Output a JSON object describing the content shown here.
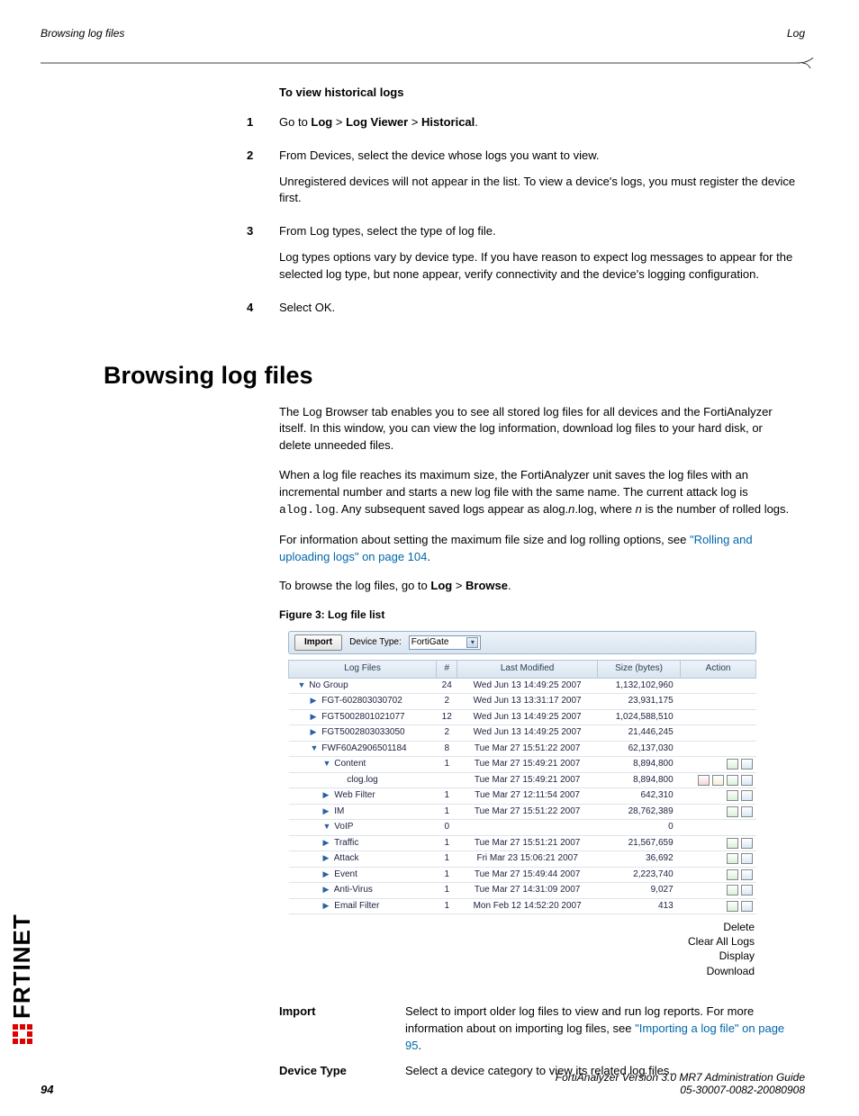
{
  "header": {
    "left": "Browsing log files",
    "right": "Log"
  },
  "proc": {
    "title": "To view historical logs",
    "steps": [
      {
        "num": "1",
        "paras": [
          {
            "segments": [
              {
                "t": "Go to "
              },
              {
                "t": "Log",
                "b": true
              },
              {
                "t": " > "
              },
              {
                "t": "Log Viewer",
                "b": true
              },
              {
                "t": " > "
              },
              {
                "t": "Historical",
                "b": true
              },
              {
                "t": "."
              }
            ]
          }
        ]
      },
      {
        "num": "2",
        "paras": [
          {
            "segments": [
              {
                "t": "From Devices, select the device whose logs you want to view."
              }
            ]
          },
          {
            "segments": [
              {
                "t": "Unregistered devices will not appear in the list. To view a device's logs, you must register the device first."
              }
            ]
          }
        ]
      },
      {
        "num": "3",
        "paras": [
          {
            "segments": [
              {
                "t": "From Log types, select the type of log file."
              }
            ]
          },
          {
            "segments": [
              {
                "t": "Log types options vary by device type. If you have reason to expect log messages to appear for the selected log type, but none appear, verify connectivity and the device's logging configuration."
              }
            ]
          }
        ]
      },
      {
        "num": "4",
        "paras": [
          {
            "segments": [
              {
                "t": "Select OK."
              }
            ]
          }
        ]
      }
    ]
  },
  "section": {
    "title": "Browsing log files",
    "paras": [
      {
        "segments": [
          {
            "t": "The Log Browser tab enables you to see all stored log files for all devices and the FortiAnalyzer itself. In this window, you can view the log information, download log files to your hard disk, or delete unneeded files."
          }
        ]
      },
      {
        "segments": [
          {
            "t": "When a log file reaches its maximum size, the FortiAnalyzer unit saves the log files with an incremental number and starts a new log file with the same name. The current attack log is "
          },
          {
            "t": "alog.log",
            "mono": true
          },
          {
            "t": ". Any subsequent saved logs appear as alog."
          },
          {
            "t": "n",
            "i": true
          },
          {
            "t": ".log, where "
          },
          {
            "t": "n",
            "i": true
          },
          {
            "t": " is the number of rolled logs."
          }
        ]
      },
      {
        "segments": [
          {
            "t": "For information about setting the maximum file size and log rolling options, see "
          },
          {
            "t": "\"Rolling and uploading logs\" on page 104",
            "link": true
          },
          {
            "t": "."
          }
        ]
      },
      {
        "segments": [
          {
            "t": "To browse the log files, go to "
          },
          {
            "t": "Log",
            "b": true
          },
          {
            "t": " > "
          },
          {
            "t": "Browse",
            "b": true
          },
          {
            "t": "."
          }
        ]
      }
    ],
    "fig_caption": "Figure 3:   Log file list"
  },
  "screenshot": {
    "toolbar": {
      "import_btn": "Import",
      "device_type_label": "Device Type:",
      "device_type_value": "FortiGate"
    },
    "columns": [
      "Log Files",
      "#",
      "Last Modified",
      "Size (bytes)",
      "Action"
    ],
    "rows": [
      {
        "indent": 0,
        "caret": "down",
        "name": "No Group",
        "num": "24",
        "date": "Wed Jun 13 14:49:25 2007",
        "size": "1,132,102,960",
        "actions": []
      },
      {
        "indent": 1,
        "caret": "right",
        "name": "FGT-602803030702",
        "num": "2",
        "date": "Wed Jun 13 13:31:17 2007",
        "size": "23,931,175",
        "actions": []
      },
      {
        "indent": 1,
        "caret": "right",
        "name": "FGT5002801021077",
        "num": "12",
        "date": "Wed Jun 13 14:49:25 2007",
        "size": "1,024,588,510",
        "actions": []
      },
      {
        "indent": 1,
        "caret": "right",
        "name": "FGT5002803033050",
        "num": "2",
        "date": "Wed Jun 13 14:49:25 2007",
        "size": "21,446,245",
        "actions": []
      },
      {
        "indent": 1,
        "caret": "down",
        "name": "FWF60A2906501184",
        "num": "8",
        "date": "Tue Mar 27 15:51:22 2007",
        "size": "62,137,030",
        "actions": []
      },
      {
        "indent": 2,
        "caret": "down",
        "name": "Content",
        "num": "1",
        "date": "Tue Mar 27 15:49:21 2007",
        "size": "8,894,800",
        "actions": [
          "disp",
          "dl"
        ]
      },
      {
        "indent": 3,
        "caret": "",
        "name": "clog.log",
        "num": "",
        "date": "Tue Mar 27 15:49:21 2007",
        "size": "8,894,800",
        "actions": [
          "del",
          "clr",
          "disp",
          "dl"
        ]
      },
      {
        "indent": 2,
        "caret": "right",
        "name": "Web Filter",
        "num": "1",
        "date": "Tue Mar 27 12:11:54 2007",
        "size": "642,310",
        "actions": [
          "disp",
          "dl"
        ]
      },
      {
        "indent": 2,
        "caret": "right",
        "name": "IM",
        "num": "1",
        "date": "Tue Mar 27 15:51:22 2007",
        "size": "28,762,389",
        "actions": [
          "disp",
          "dl"
        ]
      },
      {
        "indent": 2,
        "caret": "down",
        "name": "VoIP",
        "num": "0",
        "date": "",
        "size": "0",
        "actions": []
      },
      {
        "indent": 2,
        "caret": "right",
        "name": "Traffic",
        "num": "1",
        "date": "Tue Mar 27 15:51:21 2007",
        "size": "21,567,659",
        "actions": [
          "disp",
          "dl"
        ]
      },
      {
        "indent": 2,
        "caret": "right",
        "name": "Attack",
        "num": "1",
        "date": "Fri Mar 23 15:06:21 2007",
        "size": "36,692",
        "actions": [
          "disp",
          "dl"
        ]
      },
      {
        "indent": 2,
        "caret": "right",
        "name": "Event",
        "num": "1",
        "date": "Tue Mar 27 15:49:44 2007",
        "size": "2,223,740",
        "actions": [
          "disp",
          "dl"
        ]
      },
      {
        "indent": 2,
        "caret": "right",
        "name": "Anti-Virus",
        "num": "1",
        "date": "Tue Mar 27 14:31:09 2007",
        "size": "9,027",
        "actions": [
          "disp",
          "dl"
        ]
      },
      {
        "indent": 2,
        "caret": "right",
        "name": "Email Filter",
        "num": "1",
        "date": "Mon Feb 12 14:52:20 2007",
        "size": "413",
        "actions": [
          "disp",
          "dl"
        ]
      }
    ],
    "callouts": [
      "Delete",
      "Clear All Logs",
      "Display",
      "Download"
    ]
  },
  "defs": [
    {
      "term": "Import",
      "body": [
        {
          "t": "Select to import older log files to view and run log reports. For more information about on importing log files, see "
        },
        {
          "t": "\"Importing a log file\" on page 95",
          "link": true
        },
        {
          "t": "."
        }
      ]
    },
    {
      "term": "Device Type",
      "body": [
        {
          "t": "Select a device category to view its related log files."
        }
      ]
    }
  ],
  "footer": {
    "page": "94",
    "line1": "FortiAnalyzer Version 3.0 MR7 Administration Guide",
    "line2": "05-30007-0082-20080908"
  },
  "logo_text": "RTINET"
}
